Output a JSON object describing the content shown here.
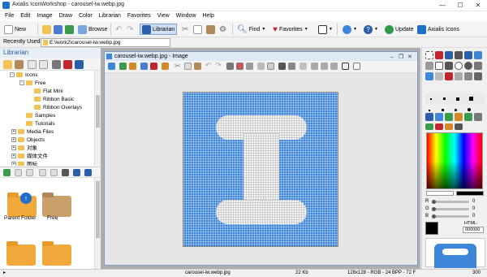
{
  "window": {
    "title": "Axialis IconWorkshop - carousel-iw.webp.jpg",
    "minimize": "—",
    "maximize": "☐",
    "close": "✕"
  },
  "menu": [
    "File",
    "Edit",
    "Image",
    "Draw",
    "Color",
    "Librarian",
    "Favorites",
    "View",
    "Window",
    "Help"
  ],
  "toolbar": {
    "new": "New",
    "browse": "Browse",
    "librarian": "Librarian",
    "find": "Find",
    "favorites": "Favorites",
    "update": "Update",
    "axialis_icons": "Axialis Icons"
  },
  "recent": {
    "label": "Recently Used",
    "path": "E:\\work2\\carousel-iw.webp.jpg"
  },
  "librarian": {
    "title": "Librarian",
    "tree": [
      {
        "label": "Icons",
        "indent": 1,
        "exp": "-"
      },
      {
        "label": "Free",
        "indent": 2,
        "exp": "-"
      },
      {
        "label": "Flat Mini",
        "indent": 3,
        "exp": ""
      },
      {
        "label": "Ribbon Basic",
        "indent": 3,
        "exp": ""
      },
      {
        "label": "Ribbon Overlays",
        "indent": 3,
        "exp": ""
      },
      {
        "label": "Samples",
        "indent": 2,
        "exp": ""
      },
      {
        "label": "Tutorials",
        "indent": 2,
        "exp": ""
      },
      {
        "label": "Media Files",
        "indent": 0,
        "exp": "+"
      },
      {
        "label": "Objects",
        "indent": 0,
        "exp": "+"
      },
      {
        "label": "对象",
        "indent": 0,
        "exp": "+"
      },
      {
        "label": "媒体文件",
        "indent": 0,
        "exp": "+"
      },
      {
        "label": "图标",
        "indent": 0,
        "exp": "+"
      }
    ],
    "items": [
      {
        "label": "Parent Folder"
      },
      {
        "label": "Free"
      }
    ]
  },
  "document": {
    "title": "carousel-iw.webp.jpg - Image"
  },
  "colors": {
    "accent": "#3d86d9",
    "foreground": "#ffffff",
    "background": "#000000"
  },
  "rgb": {
    "r_label": "R",
    "g_label": "G",
    "b_label": "B",
    "r": "0",
    "g": "0",
    "b": "0",
    "html_label": "HTML:",
    "html": "000000"
  },
  "status": {
    "file": "carousel-iw.webp.jpg",
    "size": "22 Kb",
    "info": "128x128 - RGB - 24 BPP - 72 F",
    "zoom": "300"
  }
}
